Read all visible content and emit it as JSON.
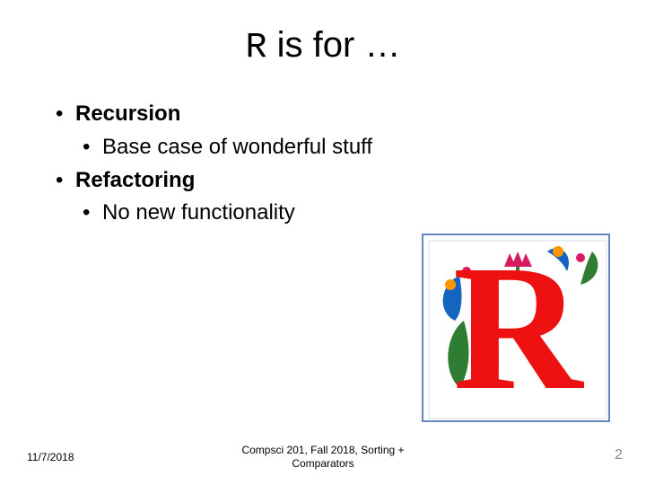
{
  "title": {
    "letter": "R",
    "rest": " is for …"
  },
  "bullets": {
    "b1": "Recursion",
    "b1a": "Base case of wonderful stuff",
    "b2": "Refactoring",
    "b2a": "No new functionality"
  },
  "footer": {
    "date": "11/7/2018",
    "center_line1": "Compsci 201, Fall 2018,  Sorting +",
    "center_line2": "Comparators",
    "page": "2"
  },
  "illustration": {
    "alt": "Decorative illuminated letter R with floral flourishes"
  }
}
